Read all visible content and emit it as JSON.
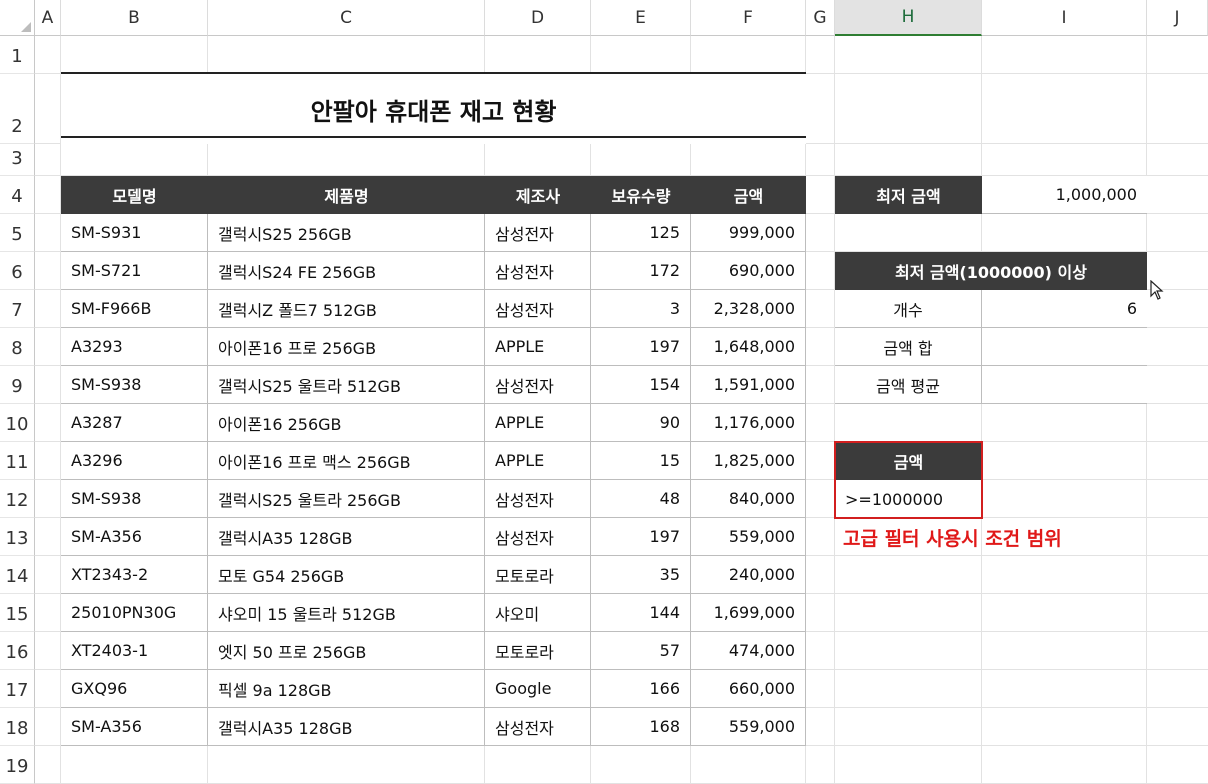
{
  "columns": [
    "A",
    "B",
    "C",
    "D",
    "E",
    "F",
    "G",
    "H",
    "I",
    "J"
  ],
  "rows": [
    "1",
    "2",
    "3",
    "4",
    "5",
    "6",
    "7",
    "8",
    "9",
    "10",
    "11",
    "12",
    "13",
    "14",
    "15",
    "16",
    "17",
    "18",
    "19"
  ],
  "title": "안팔아 휴대폰 재고 현황",
  "table": {
    "headers": [
      "모델명",
      "제품명",
      "제조사",
      "보유수량",
      "금액"
    ],
    "rows": [
      [
        "SM-S931",
        "갤럭시S25 256GB",
        "삼성전자",
        "125",
        "999,000"
      ],
      [
        "SM-S721",
        "갤럭시S24 FE 256GB",
        "삼성전자",
        "172",
        "690,000"
      ],
      [
        "SM-F966B",
        "갤럭시Z 폴드7 512GB",
        "삼성전자",
        "3",
        "2,328,000"
      ],
      [
        "A3293",
        "아이폰16 프로 256GB",
        "APPLE",
        "197",
        "1,648,000"
      ],
      [
        "SM-S938",
        "갤럭시S25 울트라 512GB",
        "삼성전자",
        "154",
        "1,591,000"
      ],
      [
        "A3287",
        "아이폰16 256GB",
        "APPLE",
        "90",
        "1,176,000"
      ],
      [
        "A3296",
        "아이폰16 프로 맥스 256GB",
        "APPLE",
        "15",
        "1,825,000"
      ],
      [
        "SM-S938",
        "갤럭시S25 울트라 256GB",
        "삼성전자",
        "48",
        "840,000"
      ],
      [
        "SM-A356",
        "갤럭시A35 128GB",
        "삼성전자",
        "197",
        "559,000"
      ],
      [
        "XT2343-2",
        "모토 G54 256GB",
        "모토로라",
        "35",
        "240,000"
      ],
      [
        "25010PN30G",
        "샤오미 15 울트라 512GB",
        "샤오미",
        "144",
        "1,699,000"
      ],
      [
        "XT2403-1",
        "엣지 50 프로 256GB",
        "모토로라",
        "57",
        "474,000"
      ],
      [
        "GXQ96",
        "픽셀 9a 128GB",
        "Google",
        "166",
        "660,000"
      ],
      [
        "SM-A356",
        "갤럭시A35 128GB",
        "삼성전자",
        "168",
        "559,000"
      ]
    ]
  },
  "side": {
    "min_label": "최저 금액",
    "min_value": "1,000,000",
    "summary_header": "최저 금액(1000000) 이상",
    "count_label": "개수",
    "count_value": "6",
    "sum_label": "금액 합",
    "sum_value": "",
    "avg_label": "금액 평균",
    "avg_value": ""
  },
  "criteria": {
    "header": "금액",
    "value": ">=1000000",
    "caption": "고급 필터 사용시 조건 범위"
  },
  "colors": {
    "header_bg": "#3b3b3b",
    "criteria_border": "#d21f1f",
    "caption": "#e01818"
  }
}
